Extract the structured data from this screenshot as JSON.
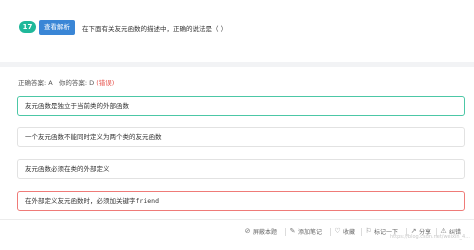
{
  "question": {
    "number": "17",
    "analysis_button": "查看解析",
    "text": "在下面有关友元函数的描述中，正确的说法是（ ）"
  },
  "answer": {
    "correct_label": "正确答案: A",
    "yours_label": "你的答案: D",
    "status": "(错误)"
  },
  "options": [
    {
      "text": "友元函数是独立于当前类的外部函数"
    },
    {
      "text": "一个友元函数不能同时定义为两个类的友元函数"
    },
    {
      "text": "友元函数必须在类的外部定义"
    },
    {
      "text_prefix": "在外部定义友元函数时，必须加关键字",
      "text_code": "friend"
    }
  ],
  "footer": {
    "items": [
      {
        "icon": "ban-icon",
        "label": "屏蔽本题"
      },
      {
        "icon": "note-icon",
        "label": "添加笔记"
      },
      {
        "icon": "heart-icon",
        "label": "收藏"
      },
      {
        "icon": "flag-icon",
        "label": "标记一下"
      },
      {
        "icon": "share-icon",
        "label": "分享"
      },
      {
        "icon": "warning-icon",
        "label": "纠错"
      }
    ],
    "watermark": "https://blog.csdn.net/weixin_4..."
  },
  "colors": {
    "accent_green": "#1fb89a",
    "button_blue": "#3a86d6",
    "correct_border": "#4cc7a6",
    "wrong_border": "#ef7b78",
    "wrong_text": "#e6504a"
  }
}
